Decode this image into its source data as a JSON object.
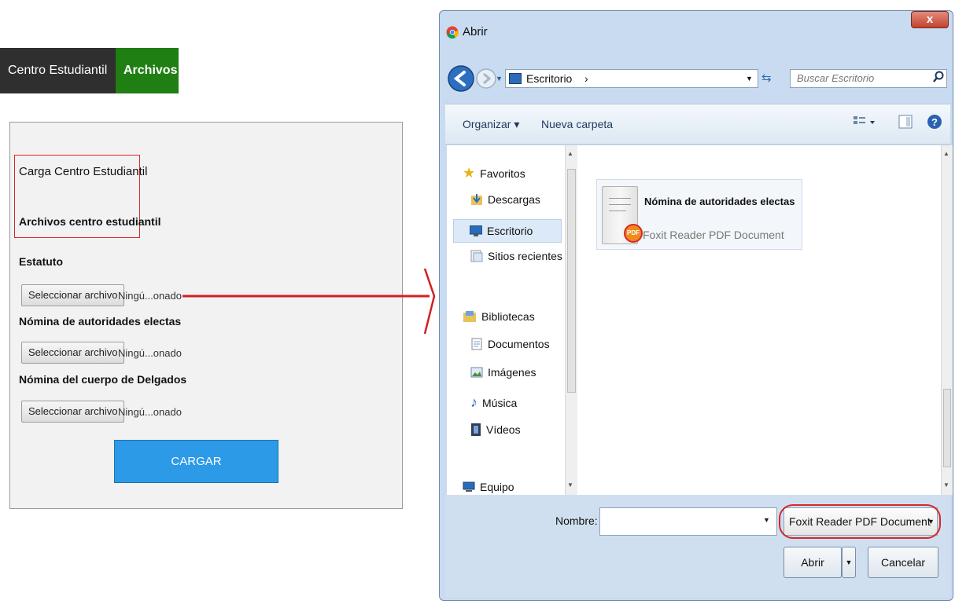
{
  "webpage": {
    "tabs": [
      {
        "label": "Centro Estudiantil"
      },
      {
        "label": "Archivos"
      }
    ],
    "form": {
      "title": "Carga Centro Estudiantil",
      "subtitle": "Archivos centro estudiantil",
      "fields": [
        {
          "label": "Estatuto",
          "button": "Seleccionar archivo",
          "status": "Ningú...onado"
        },
        {
          "label": "Nómina de autoridades electas",
          "button": "Seleccionar archivo",
          "status": "Ningú...onado"
        },
        {
          "label": "Nómina del cuerpo de Delgados",
          "button": "Seleccionar archivo",
          "status": "Ningú...onado"
        }
      ],
      "submit_label": "CARGAR"
    },
    "colors": {
      "tab_dark": "#2f2f2f",
      "tab_green": "#1f7f13",
      "submit": "#2c9ae6",
      "highlight": "#d62828"
    }
  },
  "dialog": {
    "title": "Abrir",
    "close_label": "x",
    "address": {
      "location": "Escritorio",
      "separator": "›"
    },
    "search_placeholder": "Buscar Escritorio",
    "toolbar": {
      "organize": "Organizar ▾",
      "new_folder": "Nueva carpeta"
    },
    "nav": {
      "favorites_header": "Favoritos",
      "favorites": [
        {
          "label": "Descargas",
          "icon": "downloads-icon"
        },
        {
          "label": "Escritorio",
          "icon": "desktop-icon",
          "selected": true
        },
        {
          "label": "Sitios recientes",
          "icon": "recent-places-icon"
        }
      ],
      "libraries_header": "Bibliotecas",
      "libraries": [
        {
          "label": "Documentos",
          "icon": "documents-icon"
        },
        {
          "label": "Imágenes",
          "icon": "pictures-icon"
        },
        {
          "label": "Música",
          "icon": "music-icon"
        },
        {
          "label": "Vídeos",
          "icon": "videos-icon"
        }
      ],
      "computer_label": "Equipo"
    },
    "file": {
      "name": "Nómina de autoridades electas",
      "type": "Foxit Reader PDF Document",
      "badge": "PDF"
    },
    "filename_label": "Nombre:",
    "filename_value": "",
    "filetype_value": "Foxit Reader PDF Document",
    "open_label": "Abrir",
    "cancel_label": "Cancelar"
  }
}
